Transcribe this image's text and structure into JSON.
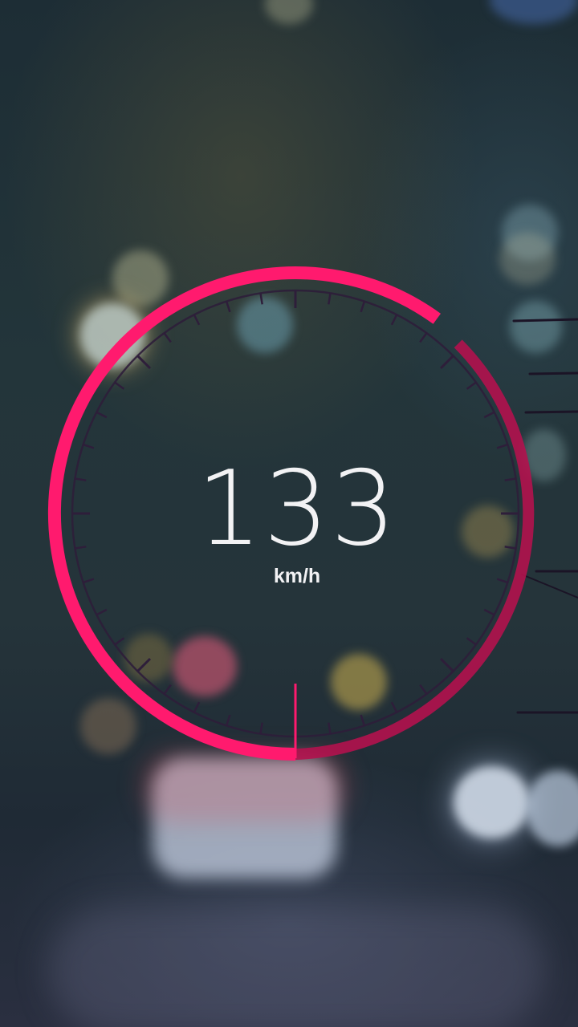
{
  "speedometer": {
    "speed": "133",
    "unit": "km/h",
    "progress_fraction": 0.6,
    "colors": {
      "arc": "#ff1a6e",
      "arc_dim": "#b3124e",
      "ticks": "#2e1e3a",
      "text": "#f2f2f4"
    }
  }
}
